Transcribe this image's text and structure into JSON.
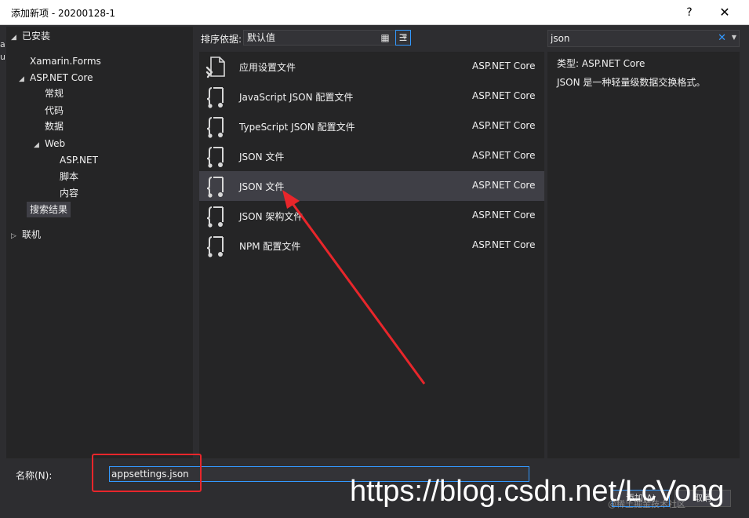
{
  "window": {
    "title": "添加新项 - 20200128-1",
    "help_label": "?",
    "close_label": "✕"
  },
  "left_edge": [
    "a",
    "ul"
  ],
  "tree": {
    "installed_label": "已安装",
    "items": [
      {
        "label": "Xamarin.Forms"
      },
      {
        "label": "ASP.NET Core"
      },
      {
        "label": "常规"
      },
      {
        "label": "代码"
      },
      {
        "label": "数据"
      },
      {
        "label": "Web"
      },
      {
        "label": "ASP.NET"
      },
      {
        "label": "脚本"
      },
      {
        "label": "内容"
      },
      {
        "label": "搜索结果"
      }
    ],
    "online_label": "联机"
  },
  "sortbar": {
    "label": "排序依据:",
    "value": "默认值"
  },
  "templates": [
    {
      "name": "应用设置文件",
      "category": "ASP.NET Core",
      "icon": "settings-file-icon"
    },
    {
      "name": "JavaScript JSON 配置文件",
      "category": "ASP.NET Core",
      "icon": "json-file-icon"
    },
    {
      "name": "TypeScript JSON 配置文件",
      "category": "ASP.NET Core",
      "icon": "json-file-icon"
    },
    {
      "name": "JSON 文件",
      "category": "ASP.NET Core",
      "icon": "json-file-icon"
    },
    {
      "name": "JSON 文件",
      "category": "ASP.NET Core",
      "icon": "json-file-icon",
      "selected": true
    },
    {
      "name": "JSON 架构文件",
      "category": "ASP.NET Core",
      "icon": "json-file-icon"
    },
    {
      "name": "NPM 配置文件",
      "category": "ASP.NET Core",
      "icon": "json-file-icon"
    }
  ],
  "search": {
    "value": "json"
  },
  "details": {
    "type_label": "类型:",
    "type_value": "ASP.NET Core",
    "description": "JSON 是一种轻量级数据交换格式。"
  },
  "bottom": {
    "name_label": "名称(N):",
    "name_value": "appsettings.json",
    "add_label": "添加(A)",
    "cancel_label": "取消"
  },
  "watermark": {
    "text": "https://blog.csdn.net/LcVong",
    "sub_text": "@稀土掘金技术社区"
  },
  "colors": {
    "accent": "#3399ff",
    "annotation_red": "#e8262b",
    "background": "#2d2d30",
    "panel": "#252526"
  }
}
